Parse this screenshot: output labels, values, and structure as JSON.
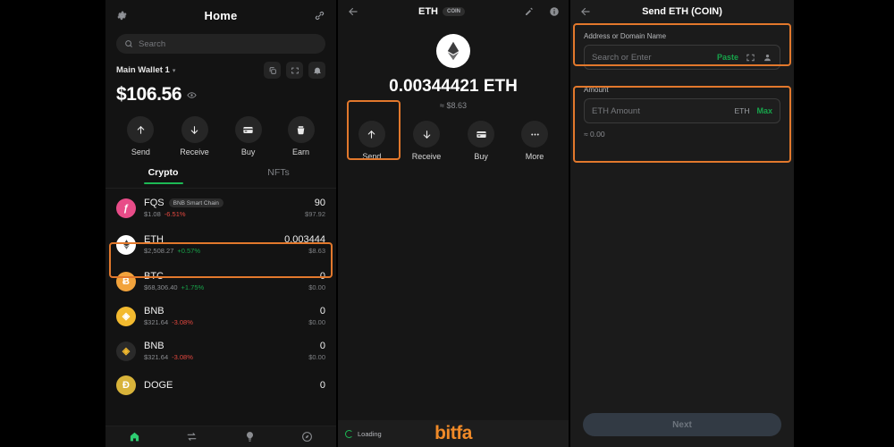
{
  "home": {
    "title": "Home",
    "gear_icon": "gear-icon",
    "link_icon": "link-icon",
    "search": {
      "placeholder": "Search",
      "value": "",
      "icon": "search-icon"
    },
    "wallet": {
      "name": "Main Wallet 1",
      "caret": "▾"
    },
    "head_buttons": [
      {
        "name": "copy-icon"
      },
      {
        "name": "scan-icon"
      },
      {
        "name": "bell-icon"
      }
    ],
    "balance": {
      "amount": "$106.56",
      "eye_icon": "eye-icon"
    },
    "actions": [
      {
        "label": "Send",
        "icon": "arrow-up-icon"
      },
      {
        "label": "Receive",
        "icon": "arrow-down-icon"
      },
      {
        "label": "Buy",
        "icon": "card-icon"
      },
      {
        "label": "Earn",
        "icon": "earn-icon"
      }
    ],
    "tabs": [
      {
        "label": "Crypto",
        "active": true
      },
      {
        "label": "NFTs",
        "active": false
      }
    ],
    "tokens": [
      {
        "symbol": "FQS",
        "chip": "BNB Smart Chain",
        "price": "$1.08",
        "change": "-6.51%",
        "change_dir": "down",
        "amount": "90",
        "usd": "$97.92",
        "color": "#e84c88",
        "glyph": "ƒ"
      },
      {
        "symbol": "ETH",
        "chip": "",
        "price": "$2,508.27",
        "change": "+0.57%",
        "change_dir": "up",
        "amount": "0.003444",
        "usd": "$8.63",
        "color": "#ffffff",
        "glyph": "◆",
        "highlighted": true
      },
      {
        "symbol": "BTC",
        "chip": "",
        "price": "$68,306.40",
        "change": "+1.75%",
        "change_dir": "up",
        "amount": "0",
        "usd": "$0.00",
        "color": "#f2a33c",
        "glyph": "Ƀ"
      },
      {
        "symbol": "BNB",
        "chip": "",
        "price": "$321.64",
        "change": "-3.08%",
        "change_dir": "down",
        "amount": "0",
        "usd": "$0.00",
        "color": "#f3ba2f",
        "glyph": "◈"
      },
      {
        "symbol": "BNB",
        "chip": "",
        "price": "$321.64",
        "change": "-3.08%",
        "change_dir": "down",
        "amount": "0",
        "usd": "$0.00",
        "color": "#2a2a2a",
        "glyph": "◈"
      },
      {
        "symbol": "DOGE",
        "chip": "",
        "price": "",
        "change": "",
        "change_dir": "up",
        "amount": "0",
        "usd": "",
        "color": "#d8b33a",
        "glyph": "Đ"
      }
    ],
    "bottom_nav": [
      {
        "name": "home-icon",
        "active": true
      },
      {
        "name": "swap-icon",
        "active": false
      },
      {
        "name": "bulb-icon",
        "active": false
      },
      {
        "name": "compass-icon",
        "active": false
      }
    ]
  },
  "asset": {
    "back_icon": "back-arrow-icon",
    "title": "ETH",
    "badge": "COIN",
    "edit_icon": "edit-icon",
    "info_icon": "info-icon",
    "logo_icon": "ethereum-icon",
    "balance": "0.00344421 ETH",
    "fiat": "≈ $8.63",
    "actions": [
      {
        "label": "Send",
        "icon": "arrow-up-icon"
      },
      {
        "label": "Receive",
        "icon": "arrow-down-icon"
      },
      {
        "label": "Buy",
        "icon": "card-icon"
      },
      {
        "label": "More",
        "icon": "more-icon"
      }
    ],
    "loading_text": "Loading",
    "brand": "bitfa"
  },
  "send": {
    "back_icon": "back-arrow-icon",
    "title": "Send ETH (COIN)",
    "address": {
      "label": "Address or Domain Name",
      "placeholder": "Search or Enter",
      "value": "",
      "paste_label": "Paste",
      "scan_icon": "scan-icon",
      "contact_icon": "contact-icon"
    },
    "amount": {
      "label": "Amount",
      "placeholder": "ETH Amount",
      "value": "",
      "unit": "ETH",
      "max_label": "Max",
      "approx": "≈ 0.00"
    },
    "next_label": "Next"
  },
  "colors": {
    "accent_orange": "#e2782c",
    "green": "#17a34a",
    "red": "#e2473f",
    "brand_orange": "#f08a28"
  }
}
